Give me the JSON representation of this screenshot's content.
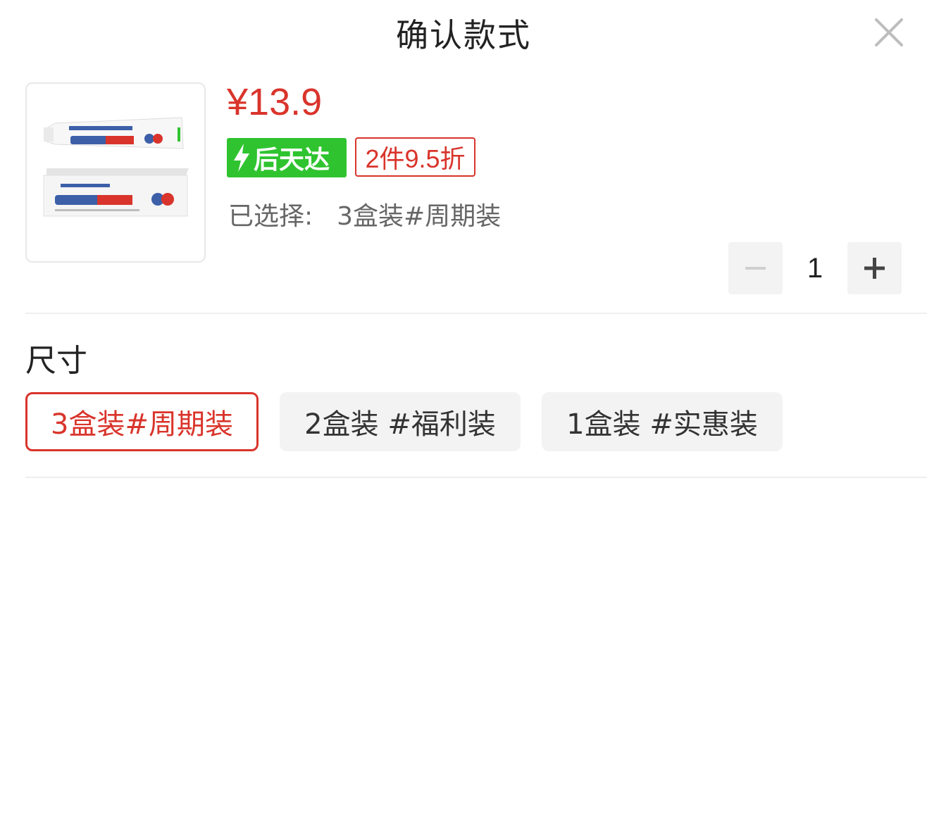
{
  "header": {
    "title": "确认款式"
  },
  "product": {
    "price": "¥13.9",
    "delivery_badge": "后天达",
    "discount_badge": "2件9.5折",
    "selected_label": "已选择:",
    "selected_value": "3盒装#周期装",
    "image_alt": "toothpaste product image"
  },
  "quantity": {
    "value": "1"
  },
  "size_section": {
    "title": "尺寸",
    "options": [
      {
        "label": "3盒装#周期装",
        "selected": true
      },
      {
        "label": "2盒装 #福利装",
        "selected": false
      },
      {
        "label": "1盒装 #实惠装",
        "selected": false
      }
    ]
  },
  "colors": {
    "accent_red": "#d9342b",
    "delivery_green": "#2fc42f",
    "chip_gray": "#f3f3f3"
  }
}
